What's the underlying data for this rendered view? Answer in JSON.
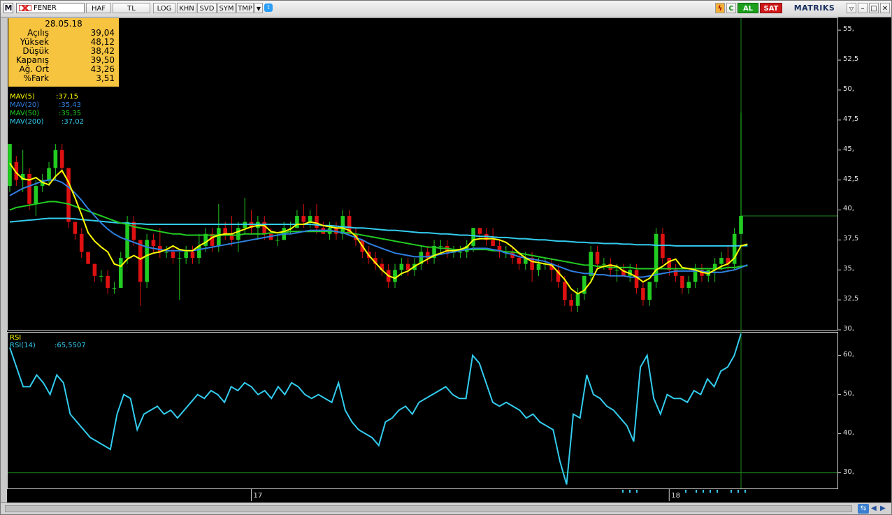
{
  "toolbar": {
    "symbol": "FENER",
    "buttons": [
      "HAF",
      "TL",
      "LOG",
      "KHN",
      "SVD",
      "SYM",
      "TMP"
    ],
    "buy_label": "AL",
    "sell_label": "SAT",
    "brand": "MATRIKS"
  },
  "ohlc_box": {
    "date": "28.05.18",
    "rows": [
      {
        "label": "Açılış",
        "value": "39,04"
      },
      {
        "label": "Yüksek",
        "value": "48,12"
      },
      {
        "label": "Düşük",
        "value": "38,42"
      },
      {
        "label": "Kapanış",
        "value": "39,50"
      },
      {
        "label": "Ağ. Ort",
        "value": "43,26"
      },
      {
        "label": "%Fark",
        "value": "3,51"
      }
    ]
  },
  "legend": [
    {
      "name": "MAV(5)",
      "value": ":37,15",
      "color": "#ffff00"
    },
    {
      "name": "MAV(20)",
      "value": ":35,43",
      "color": "#2f7fe0"
    },
    {
      "name": "MAV(50)",
      "value": ":35,35",
      "color": "#22cc22"
    },
    {
      "name": "MAV(200)",
      "value": ":37,02",
      "color": "#33ccee"
    }
  ],
  "price_axis": [
    "55,",
    "52,5",
    "50,",
    "47,5",
    "45,",
    "42,5",
    "40,",
    "37,5",
    "35,",
    "32,5",
    "30,"
  ],
  "rsi": {
    "title": "RSI",
    "name": "RSI(14)",
    "value": ":65,5507",
    "axis": [
      "60,",
      "50,",
      "40,",
      "30,"
    ]
  },
  "time_axis": [
    "17",
    "18"
  ],
  "colors": {
    "up": "#22cc22",
    "down": "#dd1111",
    "rsi": "#33ccee",
    "bg": "#000000",
    "ohlc_bg": "#f7c440"
  },
  "chart_data": {
    "type": "candlestick",
    "ylim": [
      30,
      56
    ],
    "candles": [
      [
        42,
        45.5,
        41.5,
        45.5
      ],
      [
        44,
        44.5,
        42,
        42.5
      ],
      [
        42.5,
        45,
        41.5,
        43
      ],
      [
        43,
        43.5,
        40,
        40.5
      ],
      [
        40.5,
        42.5,
        39.5,
        42
      ],
      [
        42,
        43,
        41.5,
        42.5
      ],
      [
        42.5,
        44,
        42,
        43.5
      ],
      [
        43.5,
        45.5,
        42.5,
        45
      ],
      [
        45,
        45.5,
        43,
        43.5
      ],
      [
        43.5,
        43.5,
        38.5,
        39
      ],
      [
        39,
        39,
        37.5,
        38
      ],
      [
        38,
        38.5,
        36,
        36.5
      ],
      [
        36.5,
        36.5,
        35.5,
        35.5
      ],
      [
        35.5,
        35.5,
        34,
        34.5
      ],
      [
        34.5,
        35,
        34,
        34.5
      ],
      [
        34.5,
        35,
        33,
        33.5
      ],
      [
        33.5,
        34,
        33,
        33.5
      ],
      [
        33.5,
        36.5,
        33.5,
        36
      ],
      [
        36,
        39.5,
        35.5,
        39
      ],
      [
        39,
        39.5,
        37,
        37.5
      ],
      [
        37.5,
        37.5,
        32,
        34
      ],
      [
        34,
        38,
        33.5,
        37.5
      ],
      [
        37.5,
        38,
        36.5,
        37
      ],
      [
        37,
        38.5,
        36,
        36.5
      ],
      [
        36.5,
        37,
        36,
        36.5
      ],
      [
        36.5,
        37,
        35.5,
        36
      ],
      [
        36,
        36.5,
        32.5,
        36
      ],
      [
        36,
        37,
        35.5,
        36.5
      ],
      [
        36.5,
        37,
        35.5,
        36
      ],
      [
        36,
        38,
        35.5,
        37
      ],
      [
        37,
        38.5,
        36.5,
        38
      ],
      [
        38,
        38.5,
        36.5,
        37
      ],
      [
        37,
        40.5,
        36.5,
        38.5
      ],
      [
        38.5,
        39,
        37.5,
        38
      ],
      [
        38,
        39.5,
        37,
        37.5
      ],
      [
        37.5,
        39,
        36.5,
        38.5
      ],
      [
        38.5,
        41,
        38,
        39
      ],
      [
        39,
        40,
        38,
        38.5
      ],
      [
        38.5,
        39.5,
        37.5,
        39
      ],
      [
        39,
        39.5,
        37.5,
        38
      ],
      [
        38,
        38.5,
        37.5,
        37.5
      ],
      [
        37.5,
        38,
        37,
        37.5
      ],
      [
        37.5,
        39,
        37.5,
        38.5
      ],
      [
        38.5,
        39,
        38,
        38.5
      ],
      [
        38.5,
        40,
        38.5,
        39.5
      ],
      [
        39.5,
        40.5,
        38.5,
        39
      ],
      [
        39,
        40,
        38.5,
        39.5
      ],
      [
        39.5,
        40.5,
        38,
        38.5
      ],
      [
        38.5,
        39,
        38,
        38
      ],
      [
        38,
        39,
        37.5,
        38.5
      ],
      [
        38.5,
        39,
        37.5,
        38
      ],
      [
        38,
        40,
        37.5,
        39.5
      ],
      [
        39.5,
        40,
        38,
        38
      ],
      [
        38,
        38.5,
        37,
        37.5
      ],
      [
        37.5,
        37.5,
        36,
        36.5
      ],
      [
        36.5,
        37,
        35.5,
        36
      ],
      [
        36,
        36.5,
        35,
        35.5
      ],
      [
        35.5,
        36,
        34.5,
        35
      ],
      [
        35,
        35.5,
        33.5,
        34
      ],
      [
        34,
        35.5,
        33.5,
        35
      ],
      [
        35,
        36,
        34.5,
        35.5
      ],
      [
        35.5,
        36,
        34.5,
        35
      ],
      [
        35,
        36,
        34.5,
        35.5
      ],
      [
        35.5,
        37,
        35,
        36.5
      ],
      [
        36.5,
        37,
        35.5,
        36
      ],
      [
        36,
        37.5,
        35.5,
        37
      ],
      [
        37,
        37.5,
        36.5,
        37
      ],
      [
        37,
        37.5,
        36,
        36.5
      ],
      [
        36.5,
        37,
        36,
        36.5
      ],
      [
        36.5,
        37,
        36,
        36.5
      ],
      [
        36.5,
        37.5,
        36,
        37
      ],
      [
        37,
        38.5,
        36.5,
        38.5
      ],
      [
        38.5,
        38.5,
        37.5,
        38
      ],
      [
        38,
        38.5,
        37,
        37.5
      ],
      [
        37.5,
        38.5,
        37,
        37
      ],
      [
        37,
        37.5,
        36,
        36.5
      ],
      [
        36.5,
        37,
        36,
        36.5
      ],
      [
        36.5,
        37,
        35.5,
        36
      ],
      [
        36,
        36.5,
        35,
        35.5
      ],
      [
        35.5,
        36.5,
        35,
        36
      ],
      [
        36,
        36.5,
        34,
        35
      ],
      [
        35,
        36,
        34.5,
        35.5
      ],
      [
        35.5,
        36,
        35,
        35.5
      ],
      [
        35.5,
        36,
        34,
        35
      ],
      [
        35,
        35.5,
        33.5,
        34
      ],
      [
        34,
        34.5,
        32,
        32.5
      ],
      [
        32.5,
        33,
        31.5,
        32
      ],
      [
        32,
        33.5,
        31.5,
        33
      ],
      [
        33,
        34.5,
        32.5,
        34.5
      ],
      [
        34.5,
        37,
        34,
        36.5
      ],
      [
        36.5,
        37,
        35,
        35.5
      ],
      [
        35.5,
        36,
        35,
        35.5
      ],
      [
        35.5,
        36,
        34.5,
        35
      ],
      [
        35,
        35.5,
        34,
        35
      ],
      [
        35,
        35.5,
        34.5,
        34.5
      ],
      [
        34.5,
        35.5,
        34,
        35
      ],
      [
        35,
        35.5,
        33,
        33.5
      ],
      [
        33.5,
        34,
        32,
        32.5
      ],
      [
        32.5,
        34,
        32,
        34
      ],
      [
        34,
        38.5,
        33.5,
        38
      ],
      [
        38,
        38.5,
        35.5,
        36
      ],
      [
        36,
        36,
        34.5,
        35
      ],
      [
        35,
        35.5,
        34,
        34.5
      ],
      [
        34.5,
        34.5,
        33,
        33.5
      ],
      [
        33.5,
        34.5,
        33,
        34
      ],
      [
        34,
        35.5,
        33.5,
        35
      ],
      [
        35,
        35.5,
        34,
        34.5
      ],
      [
        34.5,
        35,
        34,
        35
      ],
      [
        35,
        36,
        34,
        35.5
      ],
      [
        35.5,
        36.5,
        35,
        36
      ],
      [
        36,
        37,
        35,
        35.5
      ],
      [
        35.5,
        38.5,
        35,
        38
      ],
      [
        38,
        48.12,
        38,
        39.5
      ]
    ],
    "mav5": [
      43.9,
      43.1,
      42.6,
      42.5,
      42.7,
      42.3,
      42.1,
      42.8,
      43.3,
      42.3,
      41.0,
      39.6,
      38.1,
      37.4,
      36.9,
      36.5,
      35.5,
      35.3,
      35.9,
      36.2,
      35.9,
      36.2,
      36.4,
      36.5,
      36.7,
      37.0,
      36.7,
      36.6,
      36.6,
      37.0,
      37.3,
      37.7,
      37.9,
      38.0,
      38.0,
      38.2,
      38.4,
      38.6,
      38.7,
      38.7,
      38.2,
      38.1,
      38.2,
      38.4,
      38.8,
      38.8,
      39.0,
      38.9,
      38.7,
      38.6,
      38.5,
      38.5,
      38.3,
      37.8,
      37.0,
      36.2,
      35.6,
      35.0,
      34.5,
      34.3,
      34.7,
      34.9,
      35.3,
      35.6,
      35.9,
      36.2,
      36.4,
      36.6,
      36.6,
      36.7,
      36.9,
      37.5,
      37.6,
      37.6,
      37.6,
      37.5,
      37.3,
      36.9,
      36.4,
      36.0,
      35.7,
      35.6,
      35.5,
      35.4,
      34.8,
      34.2,
      33.4,
      33.0,
      33.3,
      34.0,
      35.1,
      35.3,
      35.4,
      35.3,
      34.9,
      34.7,
      34.4,
      34.0,
      34.3,
      35.0,
      35.3,
      35.7,
      35.9,
      35.2,
      35.1,
      35.0,
      34.8,
      34.7,
      35.0,
      35.3,
      35.5,
      36.0,
      37.0,
      37.15
    ],
    "mav20": [
      41.2,
      41.5,
      41.8,
      42.0,
      42.2,
      42.4,
      42.5,
      42.5,
      42.3,
      41.9,
      41.4,
      40.8,
      40.1,
      39.5,
      38.9,
      38.4,
      38.0,
      37.7,
      37.5,
      37.3,
      37.1,
      36.9,
      36.8,
      36.7,
      36.6,
      36.6,
      36.6,
      36.6,
      36.6,
      36.7,
      36.8,
      36.9,
      37.0,
      37.1,
      37.2,
      37.3,
      37.4,
      37.5,
      37.6,
      37.7,
      37.8,
      37.9,
      38.0,
      38.0,
      38.1,
      38.2,
      38.3,
      38.3,
      38.3,
      38.3,
      38.2,
      38.1,
      37.9,
      37.7,
      37.5,
      37.2,
      37.0,
      36.8,
      36.6,
      36.4,
      36.3,
      36.2,
      36.1,
      36.1,
      36.1,
      36.2,
      36.3,
      36.4,
      36.5,
      36.6,
      36.7,
      36.8,
      36.8,
      36.8,
      36.7,
      36.6,
      36.4,
      36.3,
      36.1,
      36.0,
      35.9,
      35.8,
      35.7,
      35.5,
      35.3,
      35.1,
      34.9,
      34.8,
      34.7,
      34.7,
      34.6,
      34.6,
      34.5,
      34.5,
      34.5,
      34.4,
      34.4,
      34.4,
      34.5,
      34.6,
      34.7,
      34.8,
      34.9,
      34.9,
      34.9,
      34.9,
      34.9,
      34.8,
      34.8,
      34.8,
      34.9,
      35.0,
      35.2,
      35.43
    ],
    "mav50": [
      40.0,
      40.2,
      40.3,
      40.4,
      40.5,
      40.6,
      40.7,
      40.7,
      40.6,
      40.5,
      40.3,
      40.1,
      39.9,
      39.7,
      39.5,
      39.3,
      39.1,
      38.9,
      38.8,
      38.6,
      38.5,
      38.4,
      38.3,
      38.2,
      38.1,
      38.0,
      38.0,
      37.9,
      37.9,
      37.9,
      37.9,
      37.9,
      37.9,
      37.9,
      37.9,
      37.9,
      38.0,
      38.0,
      38.0,
      38.0,
      38.1,
      38.1,
      38.1,
      38.2,
      38.2,
      38.2,
      38.2,
      38.2,
      38.2,
      38.2,
      38.2,
      38.1,
      38.1,
      38.0,
      37.9,
      37.8,
      37.7,
      37.6,
      37.5,
      37.4,
      37.3,
      37.2,
      37.1,
      37.0,
      36.9,
      36.9,
      36.8,
      36.8,
      36.7,
      36.7,
      36.7,
      36.7,
      36.7,
      36.7,
      36.6,
      36.6,
      36.5,
      36.5,
      36.4,
      36.3,
      36.2,
      36.1,
      36.0,
      35.9,
      35.8,
      35.7,
      35.6,
      35.5,
      35.4,
      35.4,
      35.3,
      35.3,
      35.2,
      35.2,
      35.2,
      35.2,
      35.1,
      35.1,
      35.1,
      35.1,
      35.1,
      35.1,
      35.1,
      35.1,
      35.1,
      35.1,
      35.1,
      35.1,
      35.1,
      35.1,
      35.2,
      35.2,
      35.3,
      35.35
    ],
    "mav200": [
      39.0,
      39.05,
      39.1,
      39.15,
      39.2,
      39.25,
      39.3,
      39.3,
      39.3,
      39.3,
      39.25,
      39.2,
      39.15,
      39.1,
      39.05,
      39.0,
      38.95,
      38.9,
      38.9,
      38.85,
      38.85,
      38.8,
      38.8,
      38.8,
      38.8,
      38.8,
      38.8,
      38.8,
      38.8,
      38.8,
      38.8,
      38.8,
      38.8,
      38.8,
      38.8,
      38.8,
      38.8,
      38.8,
      38.8,
      38.8,
      38.8,
      38.8,
      38.8,
      38.8,
      38.8,
      38.8,
      38.8,
      38.75,
      38.7,
      38.7,
      38.65,
      38.6,
      38.55,
      38.5,
      38.5,
      38.45,
      38.4,
      38.35,
      38.3,
      38.3,
      38.25,
      38.2,
      38.15,
      38.1,
      38.1,
      38.05,
      38.0,
      38.0,
      37.95,
      37.9,
      37.9,
      37.85,
      37.8,
      37.8,
      37.75,
      37.7,
      37.7,
      37.65,
      37.6,
      37.6,
      37.55,
      37.5,
      37.5,
      37.45,
      37.4,
      37.4,
      37.35,
      37.3,
      37.3,
      37.25,
      37.25,
      37.2,
      37.2,
      37.2,
      37.15,
      37.15,
      37.1,
      37.1,
      37.1,
      37.05,
      37.05,
      37.05,
      37.0,
      37.0,
      37.0,
      37.0,
      37.0,
      37.0,
      37.0,
      37.0,
      37.0,
      37.0,
      37.02,
      37.02
    ],
    "rsi_ylim": [
      26,
      66
    ],
    "rsi_ref": 30,
    "rsi_values": [
      62,
      57,
      52,
      52,
      55,
      53,
      50,
      55,
      53,
      45,
      43,
      41,
      39,
      38,
      37,
      36,
      45,
      50,
      49,
      41,
      45,
      46,
      47,
      45,
      46,
      44,
      46,
      48,
      50,
      49,
      51,
      50,
      48,
      52,
      51,
      53,
      52,
      50,
      51,
      49,
      52,
      50,
      53,
      52,
      50,
      49,
      50,
      49,
      48,
      53,
      46,
      43,
      41,
      40,
      39,
      37,
      43,
      44,
      46,
      47,
      45,
      48,
      49,
      50,
      51,
      52,
      50,
      49,
      49,
      60,
      58,
      53,
      48,
      47,
      48,
      47,
      46,
      44,
      45,
      43,
      42,
      41,
      33,
      27,
      45,
      44,
      55,
      50,
      49,
      47,
      46,
      44,
      42,
      38,
      57,
      60,
      49,
      45,
      50,
      49,
      49,
      48,
      51,
      50,
      54,
      52,
      56,
      57,
      60,
      65.55
    ],
    "time_labels": [
      {
        "label": "17",
        "index": 37
      },
      {
        "label": "18",
        "index": 101
      }
    ]
  }
}
